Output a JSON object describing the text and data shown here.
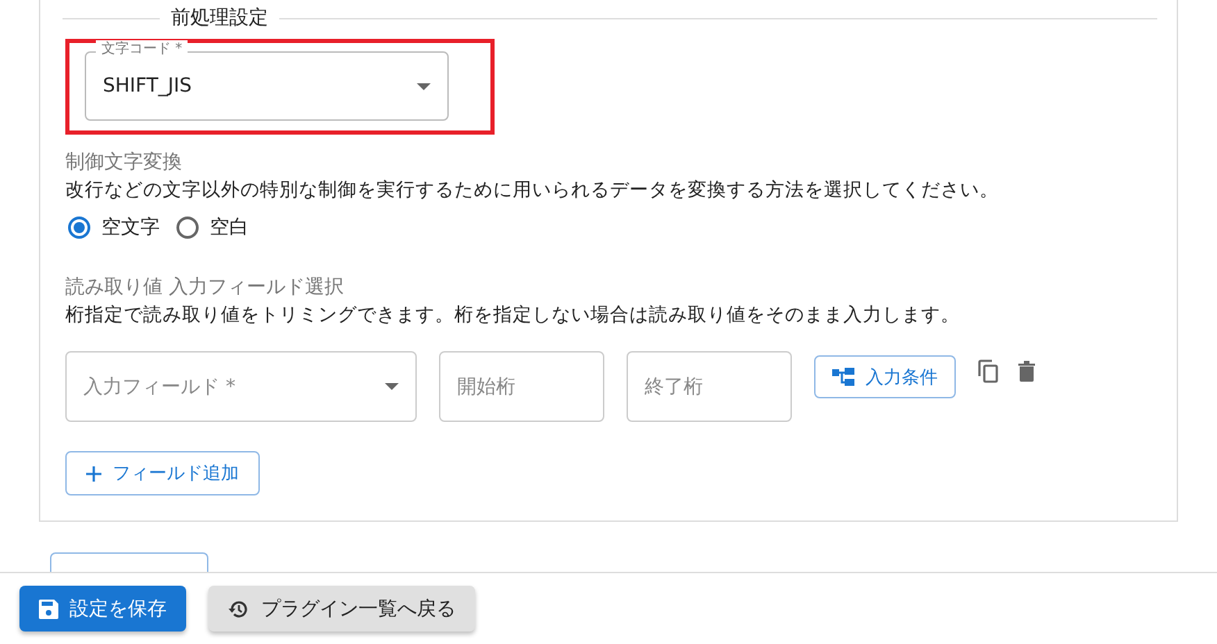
{
  "section": {
    "legend": "前処理設定"
  },
  "charset": {
    "label": "文字コード *",
    "value": "SHIFT_JIS",
    "highlighted": true
  },
  "control_char": {
    "title": "制御文字変換",
    "description": "改行などの文字以外の特別な制御を実行するために用いられるデータを変換する方法を選択してください。",
    "options": [
      {
        "label": "空文字",
        "selected": true
      },
      {
        "label": "空白",
        "selected": false
      }
    ]
  },
  "read_value": {
    "title": "読み取り値 入力フィールド選択",
    "description": "桁指定で読み取り値をトリミングできます。桁を指定しない場合は読み取り値をそのまま入力します。",
    "fields": [
      {
        "input_field": {
          "placeholder": "入力フィールド *"
        },
        "start_digit": {
          "placeholder": "開始桁"
        },
        "end_digit": {
          "placeholder": "終了桁"
        },
        "condition_button": "入力条件"
      }
    ],
    "add_button": "フィールド追加"
  },
  "footer": {
    "save_button": "設定を保存",
    "back_button": "プラグイン一覧へ戻る"
  }
}
